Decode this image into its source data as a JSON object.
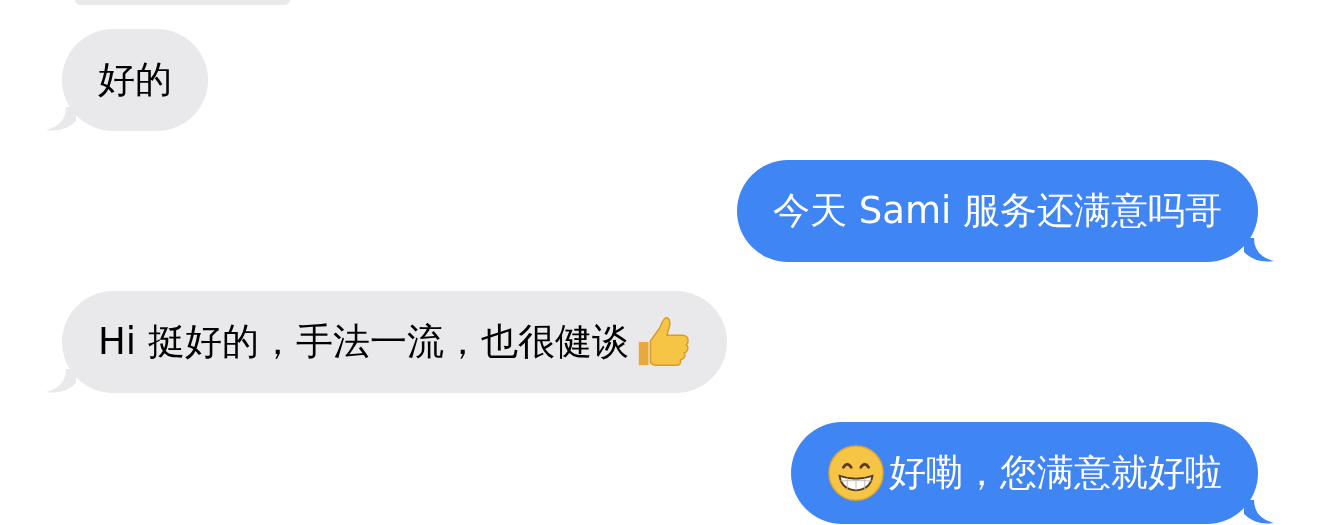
{
  "messages": [
    {
      "kind": "incoming",
      "partial": true
    },
    {
      "kind": "incoming",
      "parts": [
        {
          "kind": "text",
          "text": "好的"
        }
      ]
    },
    {
      "kind": "outgoing",
      "parts": [
        {
          "kind": "text",
          "text": "今天 Sami 服务还满意吗哥"
        }
      ]
    },
    {
      "kind": "incoming",
      "parts": [
        {
          "kind": "text",
          "text": "Hi 挺好的，手法一流，也很健谈"
        },
        {
          "kind": "thumbs-up"
        }
      ]
    },
    {
      "kind": "outgoing",
      "parts": [
        {
          "kind": "grin"
        },
        {
          "kind": "text",
          "text": "好嘞，您满意就好啦"
        }
      ]
    }
  ]
}
